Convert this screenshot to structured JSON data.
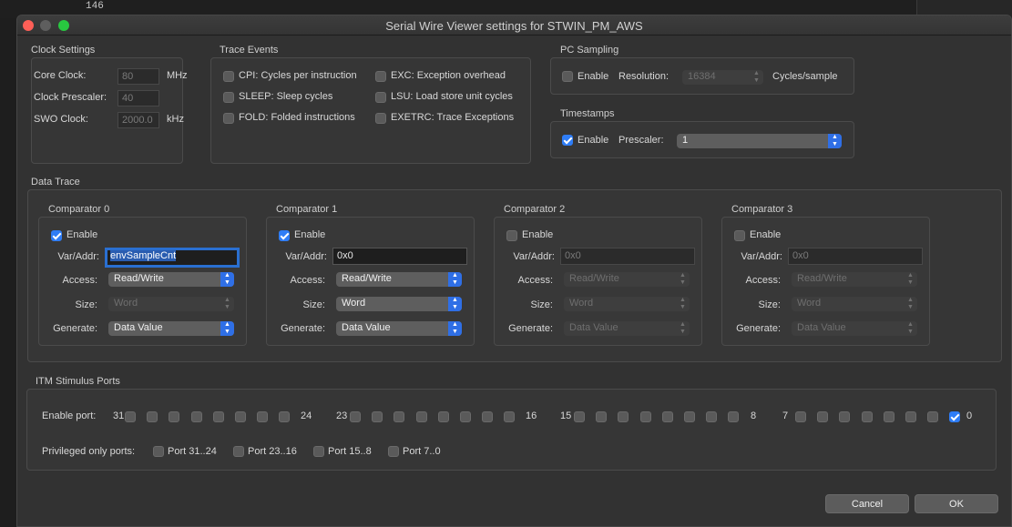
{
  "background": {
    "line_number": "146"
  },
  "window": {
    "title": "Serial Wire Viewer settings for STWIN_PM_AWS"
  },
  "clock": {
    "title": "Clock Settings",
    "core_label": "Core Clock:",
    "core_value": "80",
    "core_unit": "MHz",
    "prescaler_label": "Clock Prescaler:",
    "prescaler_value": "40",
    "swo_label": "SWO Clock:",
    "swo_value": "2000.0",
    "swo_unit": "kHz"
  },
  "trace_events": {
    "title": "Trace Events",
    "items": [
      {
        "label": "CPI: Cycles per instruction",
        "checked": false
      },
      {
        "label": "SLEEP: Sleep cycles",
        "checked": false
      },
      {
        "label": "FOLD: Folded instructions",
        "checked": false
      },
      {
        "label": "EXC: Exception overhead",
        "checked": false
      },
      {
        "label": "LSU: Load store unit cycles",
        "checked": false
      },
      {
        "label": "EXETRC: Trace Exceptions",
        "checked": false
      }
    ]
  },
  "pc_sampling": {
    "title": "PC Sampling",
    "enable_label": "Enable",
    "enabled": false,
    "resolution_label": "Resolution:",
    "resolution_value": "16384",
    "unit": "Cycles/sample"
  },
  "timestamps": {
    "title": "Timestamps",
    "enable_label": "Enable",
    "enabled": true,
    "prescaler_label": "Prescaler:",
    "prescaler_value": "1"
  },
  "data_trace": {
    "title": "Data Trace",
    "labels": {
      "enable": "Enable",
      "var": "Var/Addr:",
      "access": "Access:",
      "size": "Size:",
      "generate": "Generate:"
    },
    "comparators": [
      {
        "title": "Comparator 0",
        "enabled": true,
        "var": "envSampleCnt",
        "access": "Read/Write",
        "size": "Word",
        "generate": "Data Value"
      },
      {
        "title": "Comparator 1",
        "enabled": true,
        "var": "0x0",
        "access": "Read/Write",
        "size": "Word",
        "generate": "Data Value"
      },
      {
        "title": "Comparator 2",
        "enabled": false,
        "var": "0x0",
        "access": "Read/Write",
        "size": "Word",
        "generate": "Data Value"
      },
      {
        "title": "Comparator 3",
        "enabled": false,
        "var": "0x0",
        "access": "Read/Write",
        "size": "Word",
        "generate": "Data Value"
      }
    ]
  },
  "itm": {
    "title": "ITM Stimulus Ports",
    "enable_port_label": "Enable port:",
    "group_numbers": [
      "31",
      "24",
      "23",
      "16",
      "15",
      "8",
      "7",
      "0"
    ],
    "enabled_ports": [
      0
    ],
    "privileged_label": "Privileged only ports:",
    "privileged": [
      {
        "label": "Port 31..24",
        "checked": false
      },
      {
        "label": "Port 23..16",
        "checked": false
      },
      {
        "label": "Port 15..8",
        "checked": false
      },
      {
        "label": "Port 7..0",
        "checked": false
      }
    ]
  },
  "buttons": {
    "cancel": "Cancel",
    "ok": "OK"
  }
}
